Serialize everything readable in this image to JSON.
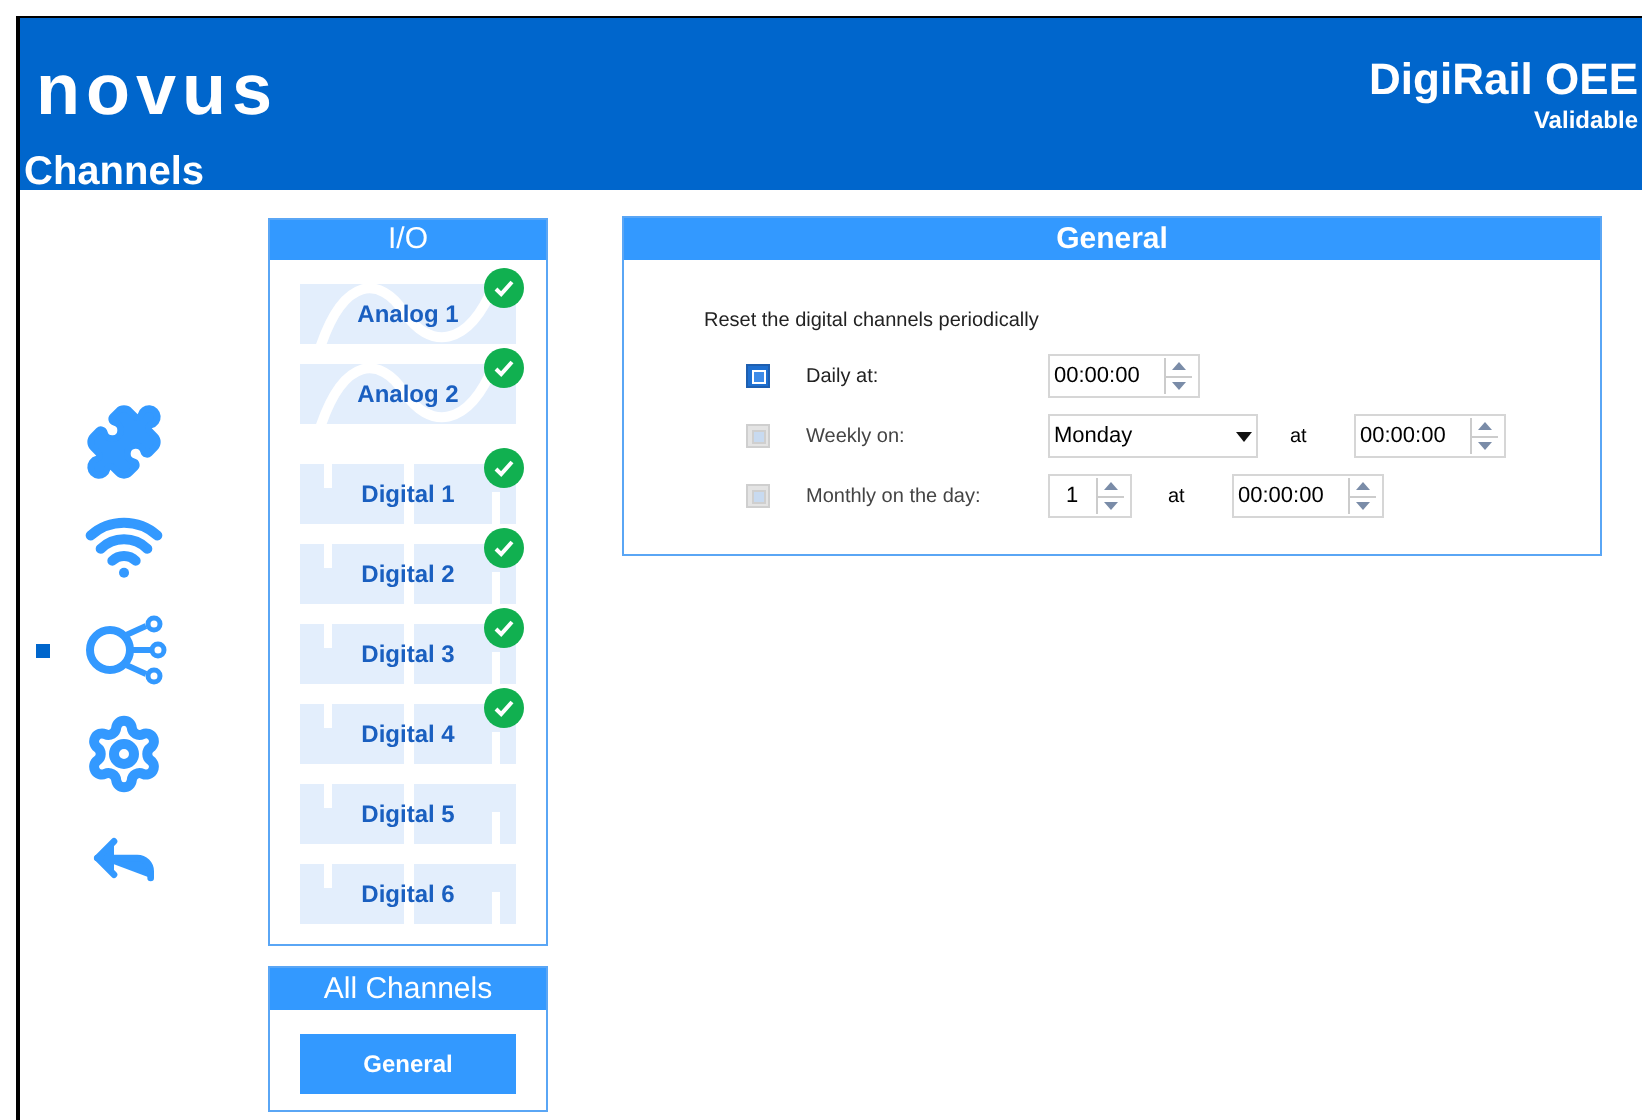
{
  "header": {
    "logo": "novus",
    "page_title": "Channels",
    "product": "DigiRail OEE",
    "subtitle": "Validable"
  },
  "nav": [
    {
      "kind": "modules",
      "selected": false
    },
    {
      "kind": "network",
      "selected": false
    },
    {
      "kind": "channels",
      "selected": true
    },
    {
      "kind": "settings",
      "selected": false
    },
    {
      "kind": "back",
      "selected": false
    }
  ],
  "io_panel": {
    "title": "I/O",
    "channels": [
      {
        "label": "Analog 1",
        "kind": "analog",
        "configured": true,
        "selected": false
      },
      {
        "label": "Analog 2",
        "kind": "analog",
        "configured": true,
        "selected": false
      },
      {
        "label": "Digital 1",
        "kind": "digital",
        "configured": true,
        "selected": false
      },
      {
        "label": "Digital 2",
        "kind": "digital",
        "configured": true,
        "selected": false
      },
      {
        "label": "Digital 3",
        "kind": "digital",
        "configured": true,
        "selected": false
      },
      {
        "label": "Digital 4",
        "kind": "digital",
        "configured": true,
        "selected": false
      },
      {
        "label": "Digital 5",
        "kind": "digital",
        "configured": false,
        "selected": false
      },
      {
        "label": "Digital 6",
        "kind": "digital",
        "configured": false,
        "selected": false
      }
    ]
  },
  "all_channels_panel": {
    "title": "All Channels",
    "items": [
      {
        "label": "General",
        "selected": true
      }
    ]
  },
  "general_panel": {
    "title": "General",
    "intro": "Reset the digital channels periodically",
    "rows": [
      {
        "kind": "daily",
        "label": "Daily at:",
        "checked": true,
        "time": "00:00:00"
      },
      {
        "kind": "weekly",
        "label": "Weekly on:",
        "checked": false,
        "day": "Monday",
        "at": "at",
        "time": "00:00:00"
      },
      {
        "kind": "monthly",
        "label": "Monthly on the day:",
        "checked": false,
        "day": "1",
        "at": "at",
        "time": "00:00:00"
      }
    ]
  }
}
